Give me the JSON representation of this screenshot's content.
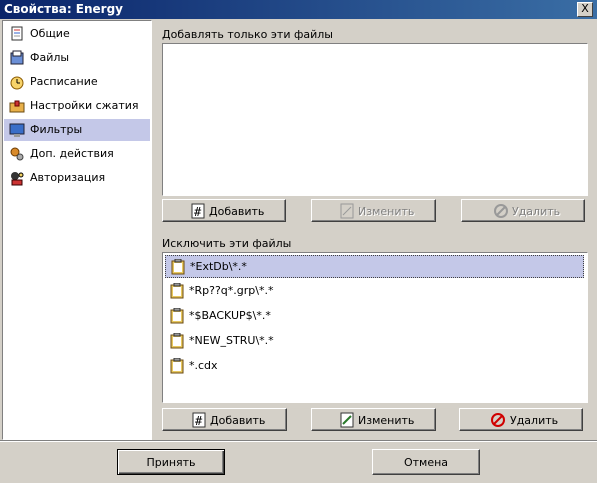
{
  "window": {
    "title": "Свойства: Energy",
    "close_label": "X"
  },
  "sidebar": {
    "items": [
      {
        "label": "Общие",
        "icon": "general-icon",
        "selected": false
      },
      {
        "label": "Файлы",
        "icon": "files-icon",
        "selected": false
      },
      {
        "label": "Расписание",
        "icon": "clock-icon",
        "selected": false
      },
      {
        "label": "Настройки сжатия",
        "icon": "compression-icon",
        "selected": false
      },
      {
        "label": "Фильтры",
        "icon": "monitor-icon",
        "selected": true
      },
      {
        "label": "Доп. действия",
        "icon": "actions-icon",
        "selected": false
      },
      {
        "label": "Авторизация",
        "icon": "authorization-icon",
        "selected": false
      }
    ]
  },
  "include": {
    "label": "Добавлять только эти файлы",
    "items": [],
    "buttons": {
      "add": "Добавить",
      "edit": "Изменить",
      "delete": "Удалить"
    }
  },
  "exclude": {
    "label": "Исключить эти файлы",
    "items": [
      {
        "label": "*ExtDb\\*.*",
        "selected": true
      },
      {
        "label": "*Rp??q*.grp\\*.*",
        "selected": false
      },
      {
        "label": "*$BACKUP$\\*.*",
        "selected": false
      },
      {
        "label": "*NEW_STRU\\*.*",
        "selected": false
      },
      {
        "label": "*.cdx",
        "selected": false
      }
    ],
    "buttons": {
      "add": "Добавить",
      "edit": "Изменить",
      "delete": "Удалить"
    }
  },
  "footer": {
    "ok": "Принять",
    "cancel": "Отмена"
  }
}
